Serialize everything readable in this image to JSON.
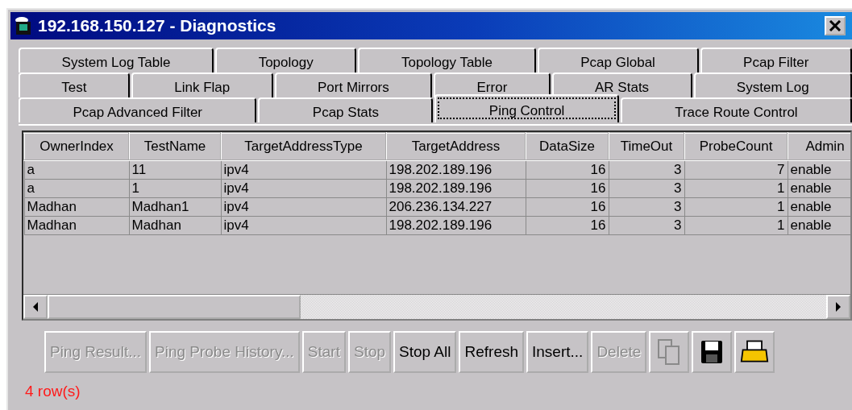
{
  "window": {
    "title": "192.168.150.127 - Diagnostics"
  },
  "tab_rows": [
    [
      {
        "label": "System Log Table",
        "selected": false
      },
      {
        "label": "Topology",
        "selected": false
      },
      {
        "label": "Topology Table",
        "selected": false
      },
      {
        "label": "Pcap Global",
        "selected": false
      },
      {
        "label": "Pcap Filter",
        "selected": false
      }
    ],
    [
      {
        "label": "Test",
        "selected": false
      },
      {
        "label": "Link Flap",
        "selected": false
      },
      {
        "label": "Port Mirrors",
        "selected": false
      },
      {
        "label": "Error",
        "selected": false
      },
      {
        "label": "AR Stats",
        "selected": false
      },
      {
        "label": "System Log",
        "selected": false
      }
    ],
    [
      {
        "label": "Pcap Advanced Filter",
        "selected": false
      },
      {
        "label": "Pcap Stats",
        "selected": false
      },
      {
        "label": "Ping Control",
        "selected": true
      },
      {
        "label": "Trace Route Control",
        "selected": false
      }
    ]
  ],
  "table": {
    "columns": [
      "OwnerIndex",
      "TestName",
      "TargetAddressType",
      "TargetAddress",
      "DataSize",
      "TimeOut",
      "ProbeCount",
      "Admin"
    ],
    "rows": [
      [
        "a",
        "11",
        "ipv4",
        "198.202.189.196",
        "16",
        "3",
        "7",
        "enable"
      ],
      [
        "a",
        "1",
        "ipv4",
        "198.202.189.196",
        "16",
        "3",
        "1",
        "enable"
      ],
      [
        "Madhan",
        "Madhan1",
        "ipv4",
        "206.236.134.227",
        "16",
        "3",
        "1",
        "enable"
      ],
      [
        "Madhan",
        "Madhan",
        "ipv4",
        "198.202.189.196",
        "16",
        "3",
        "1",
        "enable"
      ]
    ]
  },
  "buttons": [
    {
      "kind": "text",
      "label": "Ping Result...",
      "disabled": true
    },
    {
      "kind": "text",
      "label": "Ping Probe History...",
      "disabled": true
    },
    {
      "kind": "text",
      "label": "Start",
      "disabled": true
    },
    {
      "kind": "text",
      "label": "Stop",
      "disabled": true
    },
    {
      "kind": "text",
      "label": "Stop All",
      "disabled": false
    },
    {
      "kind": "text",
      "label": "Refresh",
      "disabled": false
    },
    {
      "kind": "text",
      "label": "Insert...",
      "disabled": false
    },
    {
      "kind": "text",
      "label": "Delete",
      "disabled": true
    },
    {
      "kind": "copy",
      "disabled": true
    },
    {
      "kind": "save",
      "disabled": false
    },
    {
      "kind": "print",
      "disabled": false
    }
  ],
  "status": "4 row(s)"
}
